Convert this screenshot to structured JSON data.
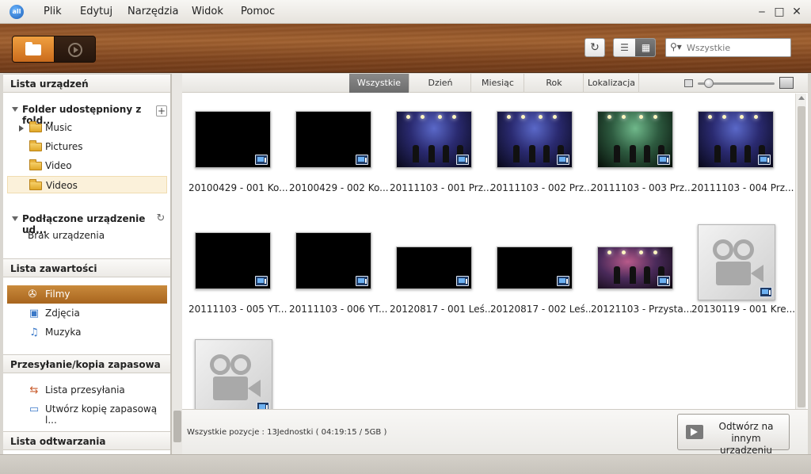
{
  "menu": {
    "logo": "all",
    "items": [
      "Plik",
      "Edytuj",
      "Narzędzia",
      "Widok",
      "Pomoc"
    ],
    "window_controls": [
      "minimize",
      "maximize",
      "close"
    ]
  },
  "toolbar": {
    "modes": [
      {
        "name": "folder",
        "icon": "folder-icon",
        "active": true
      },
      {
        "name": "play",
        "icon": "play-circle-icon",
        "active": false
      }
    ],
    "refresh_icon": "refresh-icon",
    "view_modes": [
      {
        "name": "list",
        "icon": "list-view-icon",
        "active": false
      },
      {
        "name": "grid",
        "icon": "grid-view-icon",
        "active": true
      }
    ],
    "search": {
      "placeholder": "Wszystkie",
      "value": ""
    }
  },
  "sidebar": {
    "devices": {
      "title": "Lista urządzeń",
      "shared_folder": {
        "label": "Folder udostępniony z fold...",
        "add": "+",
        "folders": [
          "Music",
          "Pictures",
          "Video",
          "Videos"
        ],
        "selected": "Videos"
      },
      "connected": {
        "label": "Podłączone urządzenie ud...",
        "empty": "Brak urządzenia"
      }
    },
    "content_list": {
      "title": "Lista zawartości",
      "items": [
        {
          "label": "Filmy",
          "icon": "film-reel-icon",
          "active": true
        },
        {
          "label": "Zdjęcia",
          "icon": "photo-icon",
          "active": false
        },
        {
          "label": "Muzyka",
          "icon": "music-note-icon",
          "active": false
        }
      ]
    },
    "transfer": {
      "title": "Przesyłanie/kopia zapasowa",
      "items": [
        {
          "label": "Lista przesyłania",
          "icon": "transfer-list-icon"
        },
        {
          "label": "Utwórz kopię zapasową l...",
          "icon": "backup-icon"
        }
      ]
    },
    "playlist": {
      "title": "Lista odtwarzania"
    }
  },
  "filters": {
    "tabs": [
      "Wszystkie",
      "Dzień",
      "Miesiąc",
      "Rok",
      "Lokalizacja"
    ],
    "active": "Wszystkie",
    "zoom_fraction": 0.14
  },
  "items": [
    {
      "label": "20100429 - 001 Ko...",
      "thumb": "black"
    },
    {
      "label": "20100429 - 002 Ko...",
      "thumb": "black"
    },
    {
      "label": "20111103 - 001 Prz...",
      "thumb": "concert"
    },
    {
      "label": "20111103 - 002 Prz...",
      "thumb": "concert"
    },
    {
      "label": "20111103 - 003 Prz...",
      "thumb": "concert-green"
    },
    {
      "label": "20111103 - 004 Prz...",
      "thumb": "concert"
    },
    {
      "label": "20111103 - 005 YT...",
      "thumb": "black"
    },
    {
      "label": "20111103 - 006 YT...",
      "thumb": "black"
    },
    {
      "label": "20120817 - 001 Leś...",
      "thumb": "black-wide"
    },
    {
      "label": "20120817 - 002 Leś...",
      "thumb": "black-wide"
    },
    {
      "label": "20121103 - Przysta...",
      "thumb": "concert-red-wide"
    },
    {
      "label": "20130119 - 001 Kre...",
      "thumb": "placeholder"
    },
    {
      "label": "",
      "thumb": "placeholder"
    }
  ],
  "status": {
    "text": "Wszystkie pozycje : 13Jednostki ( 04:19:15 / 5GB )",
    "play_button": "Odtwórz na\ninnym urządzeniu"
  }
}
